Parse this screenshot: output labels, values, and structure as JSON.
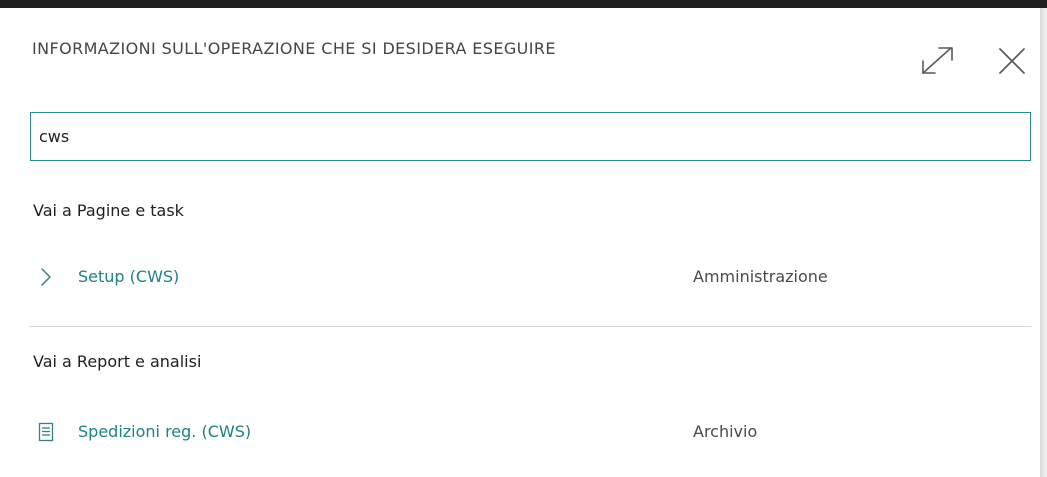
{
  "dialog": {
    "title": "INFORMAZIONI SULL'OPERAZIONE CHE SI DESIDERA ESEGUIRE",
    "expand_icon": "expand-icon",
    "close_icon": "close-icon"
  },
  "search": {
    "value": "cws",
    "placeholder": ""
  },
  "sections": [
    {
      "heading": "Vai a Pagine e task",
      "results": [
        {
          "icon": "chevron-right-icon",
          "label": "Setup (CWS)",
          "category": "Amministrazione"
        }
      ]
    },
    {
      "heading": "Vai a Report e analisi",
      "results": [
        {
          "icon": "report-icon",
          "label": "Spedizioni reg. (CWS)",
          "category": "Archivio"
        }
      ]
    }
  ],
  "colors": {
    "accent": "#1f8285",
    "input_border": "#2a8a8e",
    "text": "#212121",
    "title": "#454545",
    "divider": "#d5d5d5"
  }
}
